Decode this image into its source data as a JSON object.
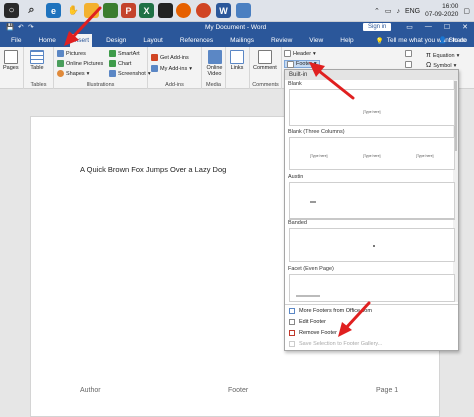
{
  "taskbar": {
    "icons": [
      "start-icon",
      "chrome-icon",
      "edge-icon",
      "folder-icon",
      "hand-icon",
      "word-icon",
      "powerpoint-icon",
      "excel-icon",
      "firefox-icon",
      "word-active-icon",
      "image-icon"
    ],
    "language": "ENG",
    "time": "16:00",
    "date": "07-09-2020"
  },
  "window": {
    "title": "My Document - Word",
    "signin": "Sign in"
  },
  "tabs": [
    "File",
    "Home",
    "Insert",
    "Design",
    "Layout",
    "References",
    "Mailings",
    "Review",
    "View",
    "Help"
  ],
  "active_tab": "Insert",
  "tellme": "Tell me what you want to do",
  "share": "Share",
  "ribbon": {
    "pages": "Pages",
    "table": "Table",
    "tables_label": "Tables",
    "pictures": "Pictures",
    "online_pictures": "Online Pictures",
    "shapes": "Shapes",
    "smartart": "SmartArt",
    "chart": "Chart",
    "screenshot": "Screenshot",
    "illustrations_label": "Illustrations",
    "get_addins": "Get Add-ins",
    "my_addins": "My Add-ins",
    "addins_label": "Add-ins",
    "online_video": "Online Video",
    "media_label": "Media",
    "links": "Links",
    "comment": "Comment",
    "comments_label": "Comments",
    "header": "Header",
    "footer": "Footer",
    "equation": "Equation",
    "symbol": "Symbol"
  },
  "document": {
    "heading": "A Quick Brown Fox Jumps Over a Lazy Dog",
    "footer_left": "Author",
    "footer_center": "Footer",
    "footer_right": "Page 1"
  },
  "gallery": {
    "builtin": "Built-in",
    "sections": [
      "Blank",
      "Blank (Three Columns)",
      "Austin",
      "Banded",
      "Facet (Even Page)"
    ],
    "thumb_blank": "[Type here]",
    "thumb_three": [
      "[Type here]",
      "[Type here]",
      "[Type here]"
    ],
    "menu": [
      "More Footers from Office.com",
      "Edit Footer",
      "Remove Footer",
      "Save Selection to Footer Gallery..."
    ]
  }
}
